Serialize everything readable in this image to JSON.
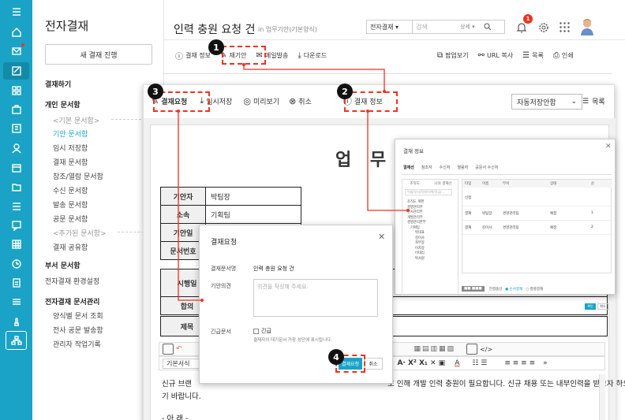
{
  "rail": {
    "icons": [
      "menu-icon",
      "home-icon",
      "mail-icon",
      "approval-icon",
      "grid-icon",
      "board-icon",
      "contacts-icon",
      "person-icon",
      "calendar-icon",
      "folder-icon",
      "list-icon",
      "chat-icon",
      "table-icon",
      "clock-icon",
      "note-icon",
      "stack-icon",
      "stamp-icon",
      "org-icon"
    ]
  },
  "menu": {
    "title": "전자결재",
    "new_btn": "새 결재 진행",
    "items": [
      {
        "t": "결재하기",
        "k": "h"
      },
      {
        "t": "개인 문서함",
        "k": "h"
      },
      {
        "t": "<기본 문서함>",
        "k": "sub"
      },
      {
        "t": "기안 문서함",
        "k": "sel"
      },
      {
        "t": "임시 저장함",
        "k": "i"
      },
      {
        "t": "결재 문서함",
        "k": "i"
      },
      {
        "t": "참조/열람 문서함",
        "k": "i"
      },
      {
        "t": "수신 문서함",
        "k": "i"
      },
      {
        "t": "발송 문서함",
        "k": "i"
      },
      {
        "t": "공문 문서함",
        "k": "i"
      },
      {
        "t": "<추가된 문서함>",
        "k": "sub"
      },
      {
        "t": "결재 공유함",
        "k": "i"
      },
      {
        "t": "부서 문서함",
        "k": "h"
      },
      {
        "t": "전자결재 환경설정",
        "k": "gear"
      },
      {
        "t": "전자결재 문서관리",
        "k": "h"
      },
      {
        "t": "양식별 문서 조회",
        "k": "i"
      },
      {
        "t": "전사 공문 발송함",
        "k": "i"
      },
      {
        "t": "관리자 작업기록",
        "k": "i"
      }
    ]
  },
  "header": {
    "title": "인력 충원 요청 건",
    "path": "in 업무기안(기본양식)",
    "search_scope": "전자결재 ▾",
    "search_placeholder": "검색",
    "detail": "상세 ▾",
    "notif_count": "1"
  },
  "toolbar1": {
    "left": [
      "결재 정보",
      "재기안",
      "메일발송",
      "다운로드"
    ],
    "right": [
      "팝업보기",
      "URL 복사",
      "목록",
      "인쇄"
    ]
  },
  "toolbar2": {
    "items": [
      "결재요청",
      "임시저장",
      "미리보기",
      "취소",
      "결재 정보"
    ],
    "autosave": "자동저장안함",
    "list": "목록"
  },
  "doc": {
    "title_glyphs": "업 무 기",
    "rows": [
      {
        "h": "기안자",
        "v": "박팀장"
      },
      {
        "h": "소속",
        "v": "기획팀"
      },
      {
        "h": "기안일",
        "v": ""
      },
      {
        "h": "문서번호",
        "v": ""
      }
    ],
    "row_exec": "시행일",
    "row_agree": "합의",
    "row_subject": "제목",
    "body1": "신규 브랜",
    "body1b": "로 인해 개발 인력 충원이 필요합니다. 신규 채용 또는 내부인력을 받고자 하오이 검토 후 재가하여 주시",
    "body2": "기 바랍니다.",
    "body3": "- 아 래 -",
    "editor_font": "기본서식"
  },
  "dialog": {
    "title": "결재요청",
    "label_doc": "결재문서명",
    "doc_name": "인력 충원 요청 건",
    "label_opinion": "기안의견",
    "opinion_placeholder": "의견을 작성해 주세요.",
    "label_urgent": "긴급문서",
    "urgent": "긴급",
    "urgent_note": "결재자의 대기문서 가장 상단에 표시됩니다.",
    "ok": "결재요청",
    "cancel": "취소"
  },
  "popup": {
    "title": "결재 정보",
    "tabs": [
      "결재선",
      "참조자",
      "수신처",
      "열람자",
      "공문서 수신처"
    ],
    "sub_tabs": [
      "조직도",
      "나의 결재선"
    ],
    "search_placeholder": "이름/부서/직위/직책/직급/...",
    "cols": [
      "타입",
      "이름",
      "부서",
      "상태",
      "순"
    ],
    "tree": [
      "조직도 개편",
      "경영관리부",
      "인사관리부",
      "개발관리부",
      "경영관리본부",
      "기획팀",
      "박대표",
      "김이사",
      "최부장",
      "이차장",
      "이대리",
      "박사원"
    ],
    "rows": [
      {
        "c": [
          "신청",
          "",
          "",
          "",
          ""
        ]
      },
      {
        "c": [
          "결재",
          "박팀장",
          "경영관리팀",
          "예정",
          "1"
        ]
      },
      {
        "c": [
          "결재",
          "김이사",
          "경영관리팀",
          "예정",
          "2"
        ]
      }
    ],
    "footer": [
      "전결옵션",
      "순서결재",
      "병렬결재"
    ],
    "ok": "확인",
    "cancel": "취소"
  },
  "annotations": [
    "1",
    "2",
    "3",
    "4"
  ],
  "colors": {
    "rail": "#1aa3c6",
    "accent": "#1aa3c6",
    "marker": "#ee3322",
    "notif": "#ee3322"
  }
}
